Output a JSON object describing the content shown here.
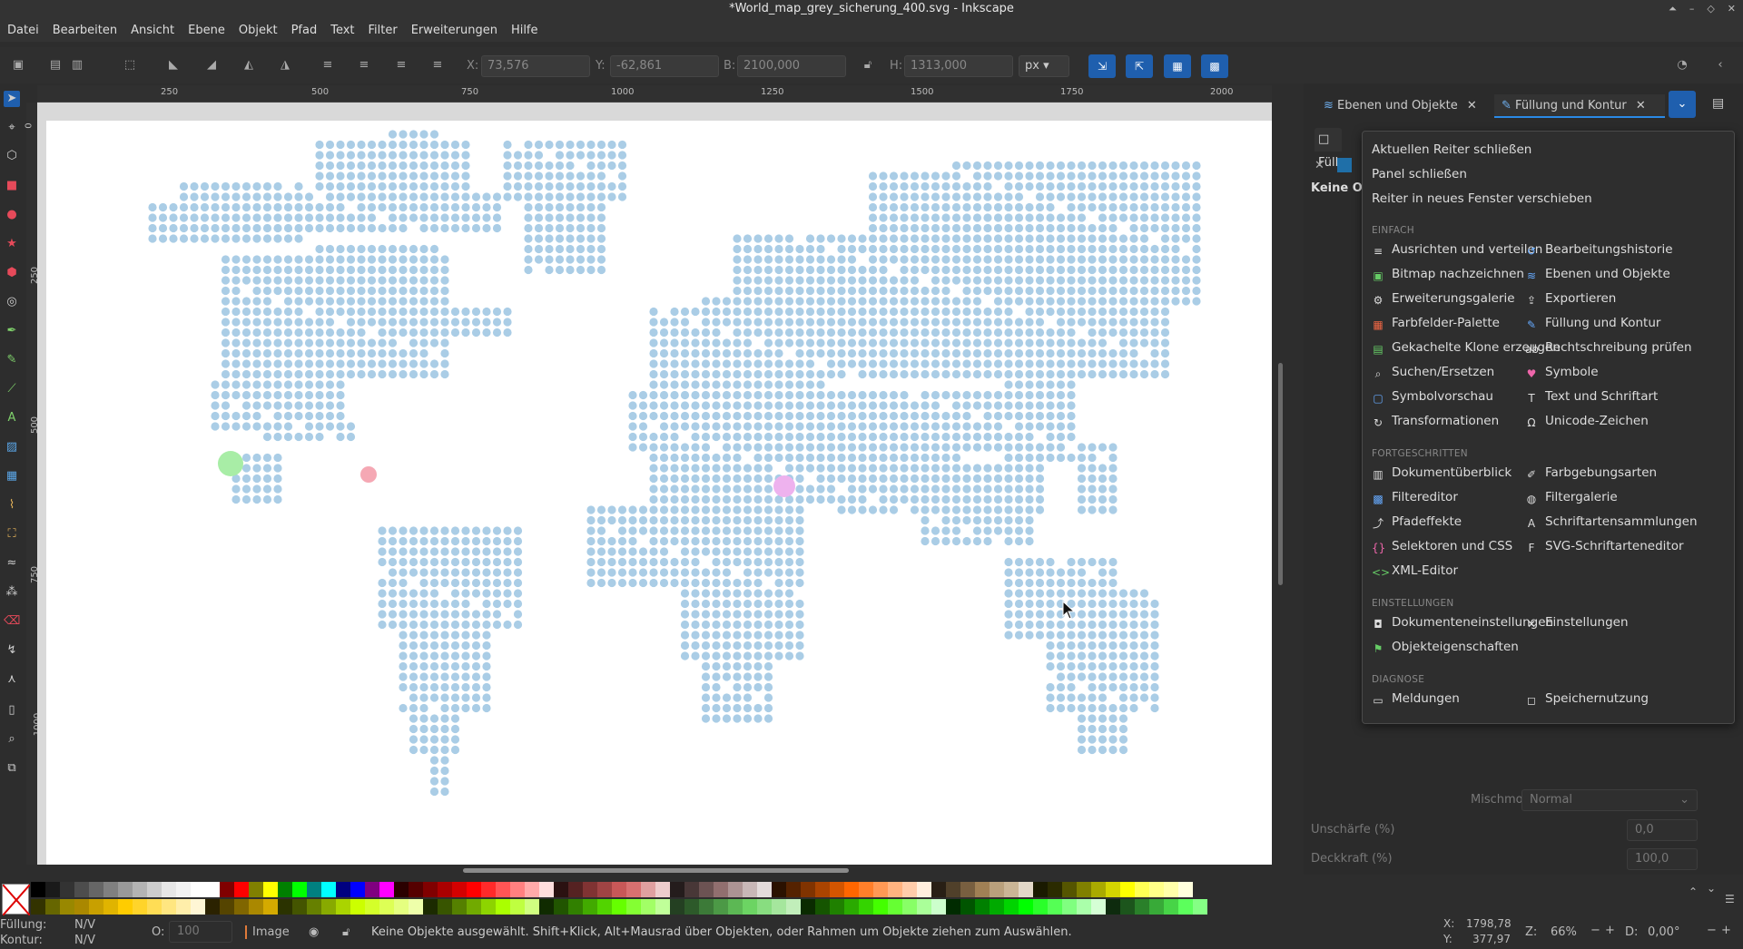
{
  "window": {
    "title": "*World_map_grey_sicherung_400.svg - Inkscape"
  },
  "menu": [
    "Datei",
    "Bearbeiten",
    "Ansicht",
    "Ebene",
    "Objekt",
    "Pfad",
    "Text",
    "Filter",
    "Erweiterungen",
    "Hilfe"
  ],
  "toolbar": {
    "x_label": "X:",
    "x_value": "73,576",
    "y_label": "Y:",
    "y_value": "-62,861",
    "w_label": "B:",
    "w_value": "2100,000",
    "h_label": "H:",
    "h_value": "1313,000",
    "unit": "px"
  },
  "ruler": {
    "h_ticks": [
      "250",
      "500",
      "750",
      "1000",
      "1250",
      "1500",
      "1750",
      "2000"
    ],
    "v_ticks": [
      "0",
      "250",
      "500",
      "750",
      "1000"
    ]
  },
  "panel": {
    "tab_layers": "Ebenen und Objekte",
    "tab_fill": "Füllung und Kontur",
    "fill_partial": "Füllu",
    "no_objects_partial": "Keine Ob",
    "blend_label": "Mischmodus:",
    "blend_value": "Normal",
    "blur_label": "Unschärfe (%)",
    "blur_value": "0,0",
    "opacity_label": "Deckkraft (%)",
    "opacity_value": "100,0"
  },
  "dropdown": {
    "top_items": [
      "Aktuellen Reiter schließen",
      "Panel schließen",
      "Reiter in neues Fenster verschieben"
    ],
    "sections": [
      {
        "title": "EINFACH",
        "items": [
          {
            "label": "Ausrichten und verteilen",
            "icon": "align-icon"
          },
          {
            "label": "Bearbeitungshistorie",
            "icon": "history-icon"
          },
          {
            "label": "Bitmap nachzeichnen",
            "icon": "trace-bitmap-icon"
          },
          {
            "label": "Ebenen und Objekte",
            "icon": "layers-icon"
          },
          {
            "label": "Erweiterungsgalerie",
            "icon": "extensions-icon"
          },
          {
            "label": "Exportieren",
            "icon": "export-icon"
          },
          {
            "label": "Farbfelder-Palette",
            "icon": "swatches-icon"
          },
          {
            "label": "Füllung und Kontur",
            "icon": "fill-stroke-icon"
          },
          {
            "label": "Gekachelte Klone erzeugen",
            "icon": "tiled-clones-icon"
          },
          {
            "label": "Rechtschreibung prüfen",
            "icon": "spellcheck-icon"
          },
          {
            "label": "Suchen/Ersetzen",
            "icon": "search-icon"
          },
          {
            "label": "Symbole",
            "icon": "symbols-icon"
          },
          {
            "label": "Symbolvorschau",
            "icon": "icon-preview-icon"
          },
          {
            "label": "Text und Schriftart",
            "icon": "text-icon"
          },
          {
            "label": "Transformationen",
            "icon": "transform-icon"
          },
          {
            "label": "Unicode-Zeichen",
            "icon": "unicode-icon"
          }
        ]
      },
      {
        "title": "FORTGESCHRITTEN",
        "items": [
          {
            "label": "Dokumentüberblick",
            "icon": "document-overview-icon"
          },
          {
            "label": "Farbgebungsarten",
            "icon": "paint-modes-icon"
          },
          {
            "label": "Filtereditor",
            "icon": "filter-editor-icon"
          },
          {
            "label": "Filtergalerie",
            "icon": "filter-gallery-icon"
          },
          {
            "label": "Pfadeffekte",
            "icon": "path-effects-icon"
          },
          {
            "label": "Schriftartensammlungen",
            "icon": "font-collections-icon"
          },
          {
            "label": "Selektoren und CSS",
            "icon": "selectors-icon"
          },
          {
            "label": "SVG-Schriftarteneditor",
            "icon": "svg-font-icon"
          },
          {
            "label": "XML-Editor",
            "icon": "xml-editor-icon"
          }
        ]
      },
      {
        "title": "EINSTELLUNGEN",
        "items": [
          {
            "label": "Dokumenteneinstellungen",
            "icon": "document-properties-icon"
          },
          {
            "label": "Einstellungen",
            "icon": "preferences-icon"
          },
          {
            "label": "Objekteigenschaften",
            "icon": "object-properties-icon"
          }
        ]
      },
      {
        "title": "DIAGNOSE",
        "items": [
          {
            "label": "Meldungen",
            "icon": "messages-icon"
          },
          {
            "label": "Speichernutzung",
            "icon": "memory-icon"
          }
        ]
      }
    ]
  },
  "status": {
    "fill_label": "Füllung:",
    "fill_value": "N/V",
    "stroke_label": "Kontur:",
    "stroke_value": "N/V",
    "opacity_label": "O:",
    "opacity_value": "100",
    "layer": "Image",
    "message": "Keine Objekte ausgewählt. Shift+Klick, Alt+Mausrad über Objekten, oder Rahmen um Objekte ziehen zum Auswählen.",
    "cursor_x_label": "X:",
    "cursor_x": "1798,78",
    "cursor_y_label": "Y:",
    "cursor_y": "377,97",
    "zoom_label": "Z:",
    "zoom": "66%",
    "rotate_label": "D:",
    "rotate": "0,00°"
  },
  "colors": {
    "accent": "#2a8ae6",
    "map_dot": "#aacde6",
    "marker_green": "#a8eda6",
    "marker_red": "#f5a8b4",
    "marker_pink": "#eeb2ee"
  }
}
